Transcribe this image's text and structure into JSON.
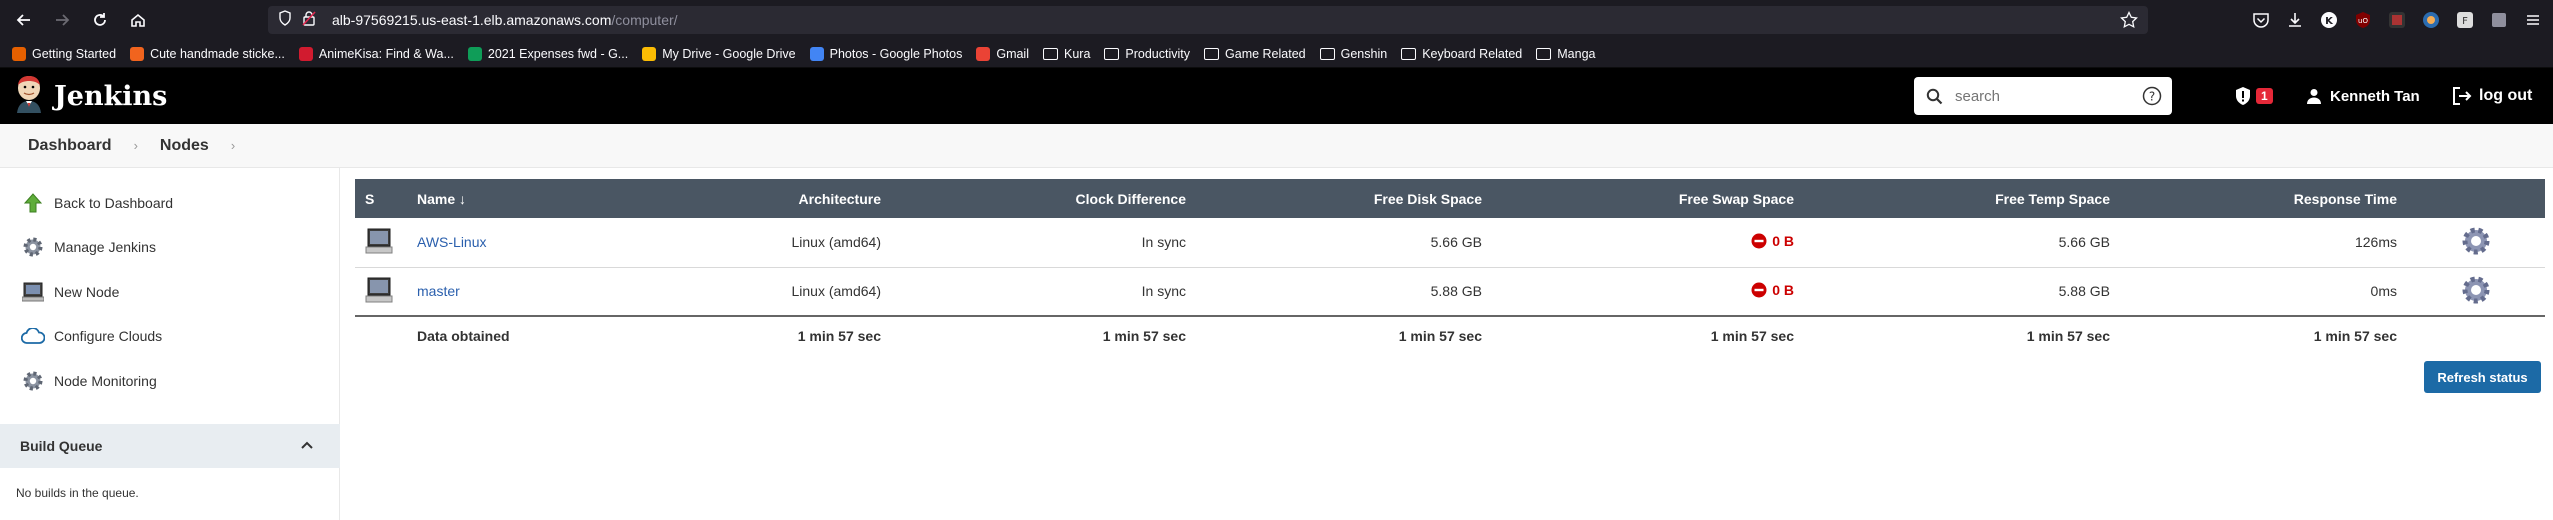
{
  "browser": {
    "url_host": "alb-97569215.us-east-1.elb.amazonaws.com",
    "url_path": "/computer/",
    "bookmarks": [
      {
        "label": "Getting Started",
        "icon": "firefox-icon",
        "color": "#e66000"
      },
      {
        "label": "Cute handmade sticke...",
        "icon": "etsy-icon",
        "color": "#f1641e"
      },
      {
        "label": "AnimeKisa: Find & Wa...",
        "icon": "animekisa-icon",
        "color": "#d11b2f"
      },
      {
        "label": "2021 Expenses fwd - G...",
        "icon": "sheets-icon",
        "color": "#0f9d58"
      },
      {
        "label": "My Drive - Google Drive",
        "icon": "drive-icon",
        "color": "#fbbc04"
      },
      {
        "label": "Photos - Google Photos",
        "icon": "photos-icon",
        "color": "#4285f4"
      },
      {
        "label": "Gmail",
        "icon": "gmail-icon",
        "color": "#ea4335"
      },
      {
        "label": "Kura",
        "icon": "folder-icon"
      },
      {
        "label": "Productivity",
        "icon": "folder-icon"
      },
      {
        "label": "Game Related",
        "icon": "folder-icon"
      },
      {
        "label": "Genshin",
        "icon": "folder-icon"
      },
      {
        "label": "Keyboard Related",
        "icon": "folder-icon"
      },
      {
        "label": "Manga",
        "icon": "folder-icon"
      }
    ]
  },
  "header": {
    "title": "Jenkins",
    "search_placeholder": "search",
    "alert_count": "1",
    "user_name": "Kenneth Tan",
    "logout_label": "log out"
  },
  "breadcrumb": [
    "Dashboard",
    "Nodes"
  ],
  "sidebar": {
    "tasks": [
      {
        "label": "Back to Dashboard",
        "icon": "up-arrow-icon"
      },
      {
        "label": "Manage Jenkins",
        "icon": "gear-icon"
      },
      {
        "label": "New Node",
        "icon": "computer-icon"
      },
      {
        "label": "Configure Clouds",
        "icon": "cloud-icon"
      },
      {
        "label": "Node Monitoring",
        "icon": "gear-icon"
      }
    ],
    "build_queue": {
      "title": "Build Queue",
      "empty_text": "No builds in the queue."
    }
  },
  "table": {
    "headers": [
      "S",
      "Name ↓",
      "Architecture",
      "Clock Difference",
      "Free Disk Space",
      "Free Swap Space",
      "Free Temp Space",
      "Response Time"
    ],
    "rows": [
      {
        "name": "AWS-Linux",
        "architecture": "Linux (amd64)",
        "clock": "In sync",
        "disk": "5.66 GB",
        "swap": "0 B",
        "temp": "5.66 GB",
        "response": "126ms"
      },
      {
        "name": "master",
        "architecture": "Linux (amd64)",
        "clock": "In sync",
        "disk": "5.88 GB",
        "swap": "0 B",
        "temp": "5.88 GB",
        "response": "0ms"
      }
    ],
    "footer": {
      "label": "Data obtained",
      "values": [
        "1 min 57 sec",
        "1 min 57 sec",
        "1 min 57 sec",
        "1 min 57 sec",
        "1 min 57 sec",
        "1 min 57 sec"
      ]
    }
  },
  "refresh_label": "Refresh status",
  "colors": {
    "header_bg": "#000000",
    "table_head_bg": "#4a5663",
    "link": "#2a5fad",
    "error": "#cc0000",
    "button": "#1c6aa6"
  }
}
